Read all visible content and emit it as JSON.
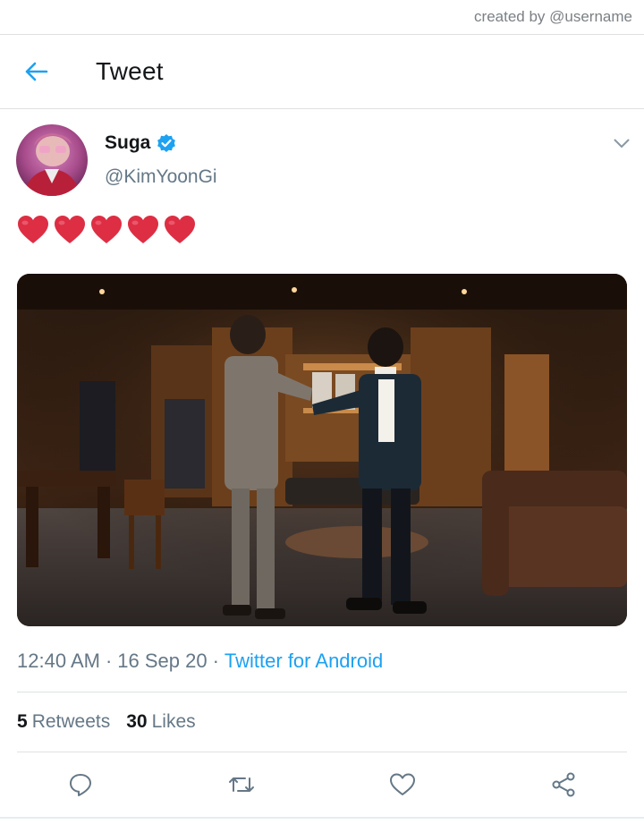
{
  "credit": "created by @username",
  "header": {
    "title": "Tweet"
  },
  "tweet": {
    "display_name": "Suga",
    "handle": "@KimYoonGi",
    "verified": true,
    "text": "❤️❤️❤️❤️❤️",
    "heart_count": 5,
    "time": "12:40 AM",
    "date": "16 Sep 20",
    "separator": "·",
    "source": "Twitter for Android",
    "retweets": {
      "count": "5",
      "label": "Retweets"
    },
    "likes": {
      "count": "30",
      "label": "Likes"
    }
  },
  "icons": {
    "back": "arrow-left-icon",
    "verified": "verified-badge-icon",
    "caret": "chevron-down-icon",
    "reply": "reply-icon",
    "retweet": "retweet-icon",
    "like": "heart-icon",
    "share": "share-icon"
  },
  "colors": {
    "accent": "#1da1f2",
    "text_primary": "#14171a",
    "text_secondary": "#657786",
    "divider": "#dde1e4",
    "heart_emoji": "#dd2e44"
  }
}
